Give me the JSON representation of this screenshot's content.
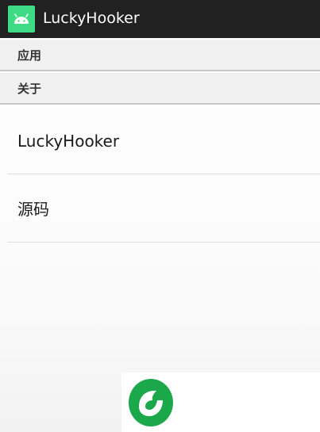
{
  "app": {
    "title": "LuckyHooker",
    "icon": "android-robot-icon",
    "accent_color": "#3ddc84",
    "titlebar_color": "#212121"
  },
  "categories": [
    {
      "label": "应用"
    },
    {
      "label": "关于"
    }
  ],
  "about_items": [
    {
      "title": "LuckyHooker"
    },
    {
      "title": "源码"
    }
  ],
  "watermark": {
    "icon": "green-leaf-g-logo-icon",
    "color": "#1aa84a"
  }
}
